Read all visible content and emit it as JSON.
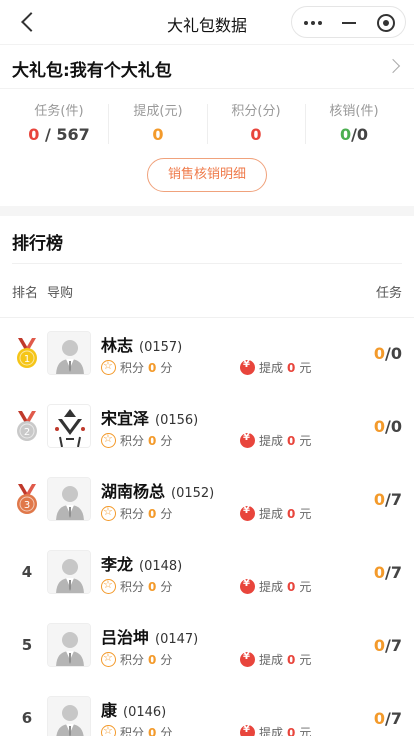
{
  "nav": {
    "title": "大礼包数据"
  },
  "gift": {
    "title": "大礼包:我有个大礼包"
  },
  "stats": [
    {
      "label": "任务(件)",
      "value_a": "0",
      "sep": " / ",
      "value_b": "567"
    },
    {
      "label": "提成(元)",
      "value": "0"
    },
    {
      "label": "积分(分)",
      "value": "0"
    },
    {
      "label": "核销(件)",
      "value_a": "0",
      "sep": "/",
      "value_b": "0"
    }
  ],
  "detail_button": "销售核销明细",
  "ranking": {
    "title": "排行榜",
    "col_rank": "排名",
    "col_guide": "导购",
    "col_task": "任务",
    "points_label": "积分",
    "points_unit": "分",
    "commission_label": "提成",
    "commission_unit": "元",
    "rows": [
      {
        "rank": "1",
        "medal": "gold",
        "name": "林志",
        "code": "(0157)",
        "points": "0",
        "commission": "0",
        "done": "0",
        "total": "/0",
        "avatar": "person-avatar"
      },
      {
        "rank": "2",
        "medal": "silver",
        "name": "宋宜泽",
        "code": "(0156)",
        "points": "0",
        "commission": "0",
        "done": "0",
        "total": "/0",
        "avatar": "logo-avatar"
      },
      {
        "rank": "3",
        "medal": "bronze",
        "name": "湖南杨总",
        "code": "(0152)",
        "points": "0",
        "commission": "0",
        "done": "0",
        "total": "/7",
        "avatar": "person-avatar"
      },
      {
        "rank": "4",
        "medal": "",
        "name": "李龙",
        "code": "(0148)",
        "points": "0",
        "commission": "0",
        "done": "0",
        "total": "/7",
        "avatar": "person-avatar"
      },
      {
        "rank": "5",
        "medal": "",
        "name": "吕治坤",
        "code": "(0147)",
        "points": "0",
        "commission": "0",
        "done": "0",
        "total": "/7",
        "avatar": "person-avatar"
      },
      {
        "rank": "6",
        "medal": "",
        "name": "康",
        "code": "(0146)",
        "points": "0",
        "commission": "0",
        "done": "0",
        "total": "/7",
        "avatar": "person-avatar"
      }
    ]
  },
  "colors": {
    "accent_orange": "#f39a2b",
    "accent_red": "#e8453c",
    "green": "#4caf50",
    "gold": "#f5c518",
    "silver": "#c9c9c9",
    "bronze": "#e0784a",
    "ribbon": "#c0392b"
  }
}
